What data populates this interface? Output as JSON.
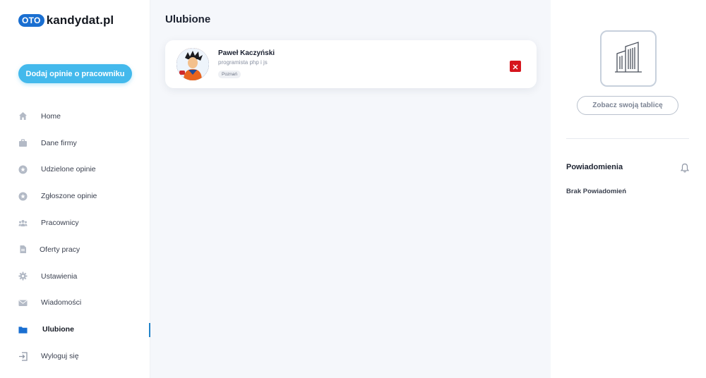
{
  "brand": {
    "badge": "OTO",
    "name": "kandydat.pl"
  },
  "sidebar": {
    "cta_label": "Dodaj opinie o pracowniku",
    "items": [
      {
        "label": "Home",
        "icon": "home-icon",
        "active": false
      },
      {
        "label": "Dane firmy",
        "icon": "briefcase-icon",
        "active": false
      },
      {
        "label": "Udzielone opinie",
        "icon": "star-icon",
        "active": false
      },
      {
        "label": "Zgłoszone opinie",
        "icon": "star-icon",
        "active": false
      },
      {
        "label": "Pracownicy",
        "icon": "users-icon",
        "active": false
      },
      {
        "label": "Oferty pracy",
        "icon": "document-icon",
        "active": false
      },
      {
        "label": "Ustawienia",
        "icon": "gear-icon",
        "active": false
      },
      {
        "label": "Wiadomości",
        "icon": "envelope-icon",
        "active": false
      },
      {
        "label": "Ulubione",
        "icon": "folder-icon",
        "active": true
      },
      {
        "label": "Wyloguj się",
        "icon": "logout-icon",
        "active": false
      }
    ]
  },
  "main": {
    "title": "Ulubione",
    "favorites": [
      {
        "name": "Paweł Kaczyński",
        "role": "programista php i js",
        "city": "Poznań"
      }
    ]
  },
  "right": {
    "board_button": "Zobacz swoją tablicę",
    "notifications_title": "Powiadomienia",
    "notifications_empty": "Brak Powiadomień"
  },
  "colors": {
    "accent": "#43b9ec",
    "brand_blue": "#1a6fd1",
    "active_indicator": "#2384c8",
    "remove_red": "#d6161e",
    "active_icon": "#1a6fd1",
    "icon_gray": "#b3bac6"
  }
}
